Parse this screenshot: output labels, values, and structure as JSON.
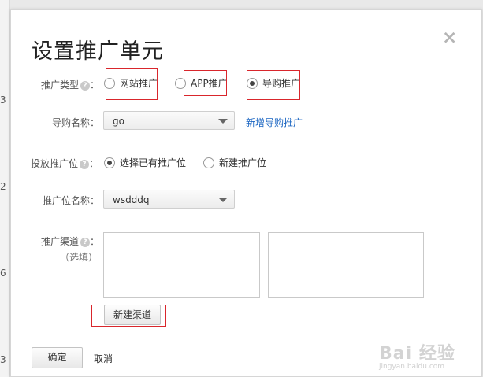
{
  "background": {
    "row_digits": [
      "3",
      "2",
      "6",
      "3"
    ]
  },
  "dialog": {
    "title": "设置推广单元",
    "close_glyph": "×",
    "promo_type": {
      "label": "推广类型",
      "help": "?",
      "options": [
        "网站推广",
        "APP推广",
        "导购推广"
      ],
      "selected": "导购推广"
    },
    "shopping_name": {
      "label": "导购名称：",
      "value": "go",
      "add_link": "新增导购推广"
    },
    "placement": {
      "label": "投放推广位",
      "help": "?",
      "options": [
        "选择已有推广位",
        "新建推广位"
      ],
      "selected": "选择已有推广位"
    },
    "placement_name": {
      "label": "推广位名称：",
      "value": "wsdddq"
    },
    "channel": {
      "label": "推广渠道",
      "help": "?",
      "optional": "（选填）",
      "new_button": "新建渠道"
    },
    "confirm_button": "确定",
    "cancel_button": "取消"
  },
  "watermark": {
    "logo": "Bai 经验",
    "url": "jingyan.baidu.com"
  },
  "colors": {
    "highlight": "#d9262c",
    "link": "#1a65c2"
  }
}
